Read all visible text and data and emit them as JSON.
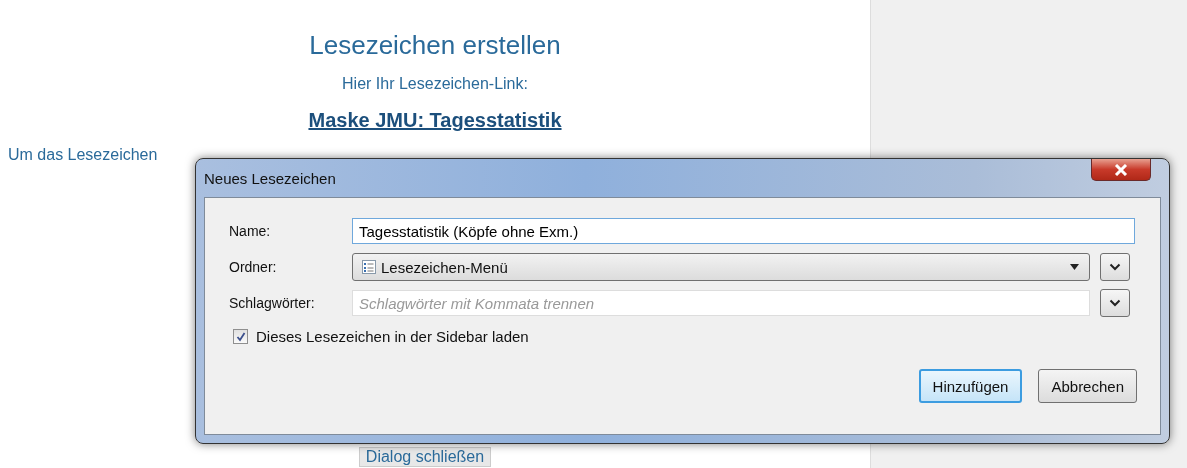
{
  "page": {
    "heading": "Lesezeichen erstellen",
    "subtitle": "Hier Ihr Lesezeichen-Link:",
    "link": "Maske JMU: Tagesstatistik",
    "instruction": "Um das Lesezeichen",
    "close_button": "Dialog schließen"
  },
  "dialog": {
    "title": "Neues Lesezeichen",
    "fields": [
      {
        "kind": "text",
        "label": "Name:",
        "value": "Tagesstatistik (Köpfe ohne Exm.)"
      },
      {
        "kind": "select",
        "label": "Ordner:",
        "value": "Lesezeichen-Menü"
      },
      {
        "kind": "tags",
        "label": "Schlagwörter:",
        "placeholder": "Schlagwörter mit Kommata trennen"
      }
    ],
    "checkbox": {
      "label": "Dieses Lesezeichen in der Sidebar laden",
      "checked": true
    },
    "buttons": [
      {
        "label": "Hinzufügen",
        "focused": true
      },
      {
        "label": "Abbrechen",
        "focused": false
      }
    ]
  }
}
